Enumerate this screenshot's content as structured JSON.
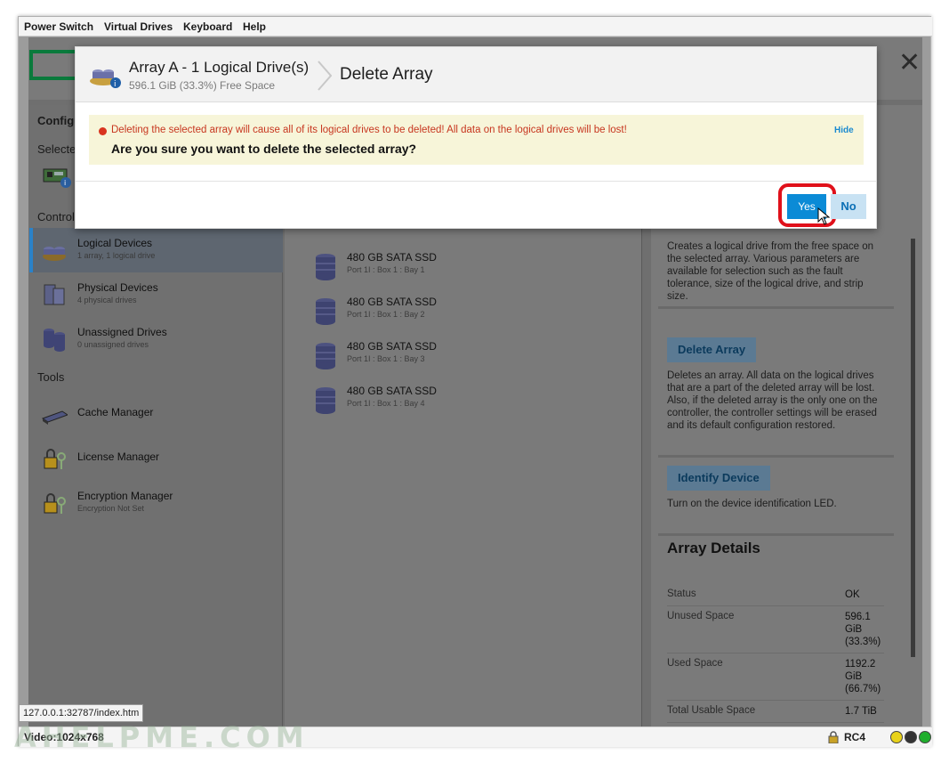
{
  "menubar": {
    "items": [
      "Power Switch",
      "Virtual Drives",
      "Keyboard",
      "Help"
    ]
  },
  "sidebar": {
    "config_heading": "Configu",
    "selected_heading": "Selecte",
    "controller_heading": "Control",
    "tools_heading": "Tools",
    "items": [
      {
        "label": "Logical Devices",
        "sub": "1 array, 1 logical drive",
        "icon": "logical-devices-icon"
      },
      {
        "label": "Physical Devices",
        "sub": "4 physical drives",
        "icon": "physical-devices-icon"
      },
      {
        "label": "Unassigned Drives",
        "sub": "0 unassigned drives",
        "icon": "unassigned-drives-icon"
      }
    ],
    "tools": [
      {
        "label": "Cache Manager",
        "sub": "",
        "icon": "cache-manager-icon"
      },
      {
        "label": "License Manager",
        "sub": "",
        "icon": "license-manager-icon"
      },
      {
        "label": "Encryption Manager",
        "sub": "Encryption Not Set",
        "icon": "encryption-manager-icon"
      }
    ]
  },
  "drives": [
    {
      "name": "480 GB SATA SSD",
      "location": "Port 1I : Box 1 : Bay 1"
    },
    {
      "name": "480 GB SATA SSD",
      "location": "Port 1I : Box 1 : Bay 2"
    },
    {
      "name": "480 GB SATA SSD",
      "location": "Port 1I : Box 1 : Bay 3"
    },
    {
      "name": "480 GB SATA SSD",
      "location": "Port 1I : Box 1 : Bay 4"
    }
  ],
  "right_panel": {
    "create_desc": "Creates a logical drive from the free space on the selected array. Various parameters are available for selection such as the fault tolerance, size of the logical drive, and strip size.",
    "delete_label": "Delete Array",
    "delete_desc": "Deletes an array. All data on the logical drives that are a part of the deleted array will be lost. Also, if the deleted array is the only one on the controller, the controller settings will be erased and its default configuration restored.",
    "identify_label": "Identify Device",
    "identify_desc": "Turn on the device identification LED.",
    "details_title": "Array Details",
    "details": [
      {
        "label": "Status",
        "value": "OK"
      },
      {
        "label": "Unused Space",
        "value": "596.1 GiB (33.3%)"
      },
      {
        "label": "Used Space",
        "value": "1192.2 GiB (66.7%)"
      },
      {
        "label": "Total Usable Space",
        "value": "1.7 TiB"
      }
    ]
  },
  "dialog": {
    "title": "Array A - 1 Logical Drive(s)",
    "subtitle": "596.1 GiB (33.3%) Free Space",
    "action": "Delete Array",
    "warning": "Deleting the selected array will cause all of its logical drives to be deleted! All data on the logical drives will be lost!",
    "hide_label": "Hide",
    "question": "Are you sure you want to delete the selected array?",
    "yes_label": "Yes",
    "no_label": "No"
  },
  "status": {
    "url": "127.0.0.1:32787/index.htm",
    "video": "Video:1024x768",
    "cipher": "RC4",
    "watermark": "AHELPME.COM",
    "led_colors": [
      "#e8d21a",
      "#333333",
      "#1fae2c"
    ]
  }
}
